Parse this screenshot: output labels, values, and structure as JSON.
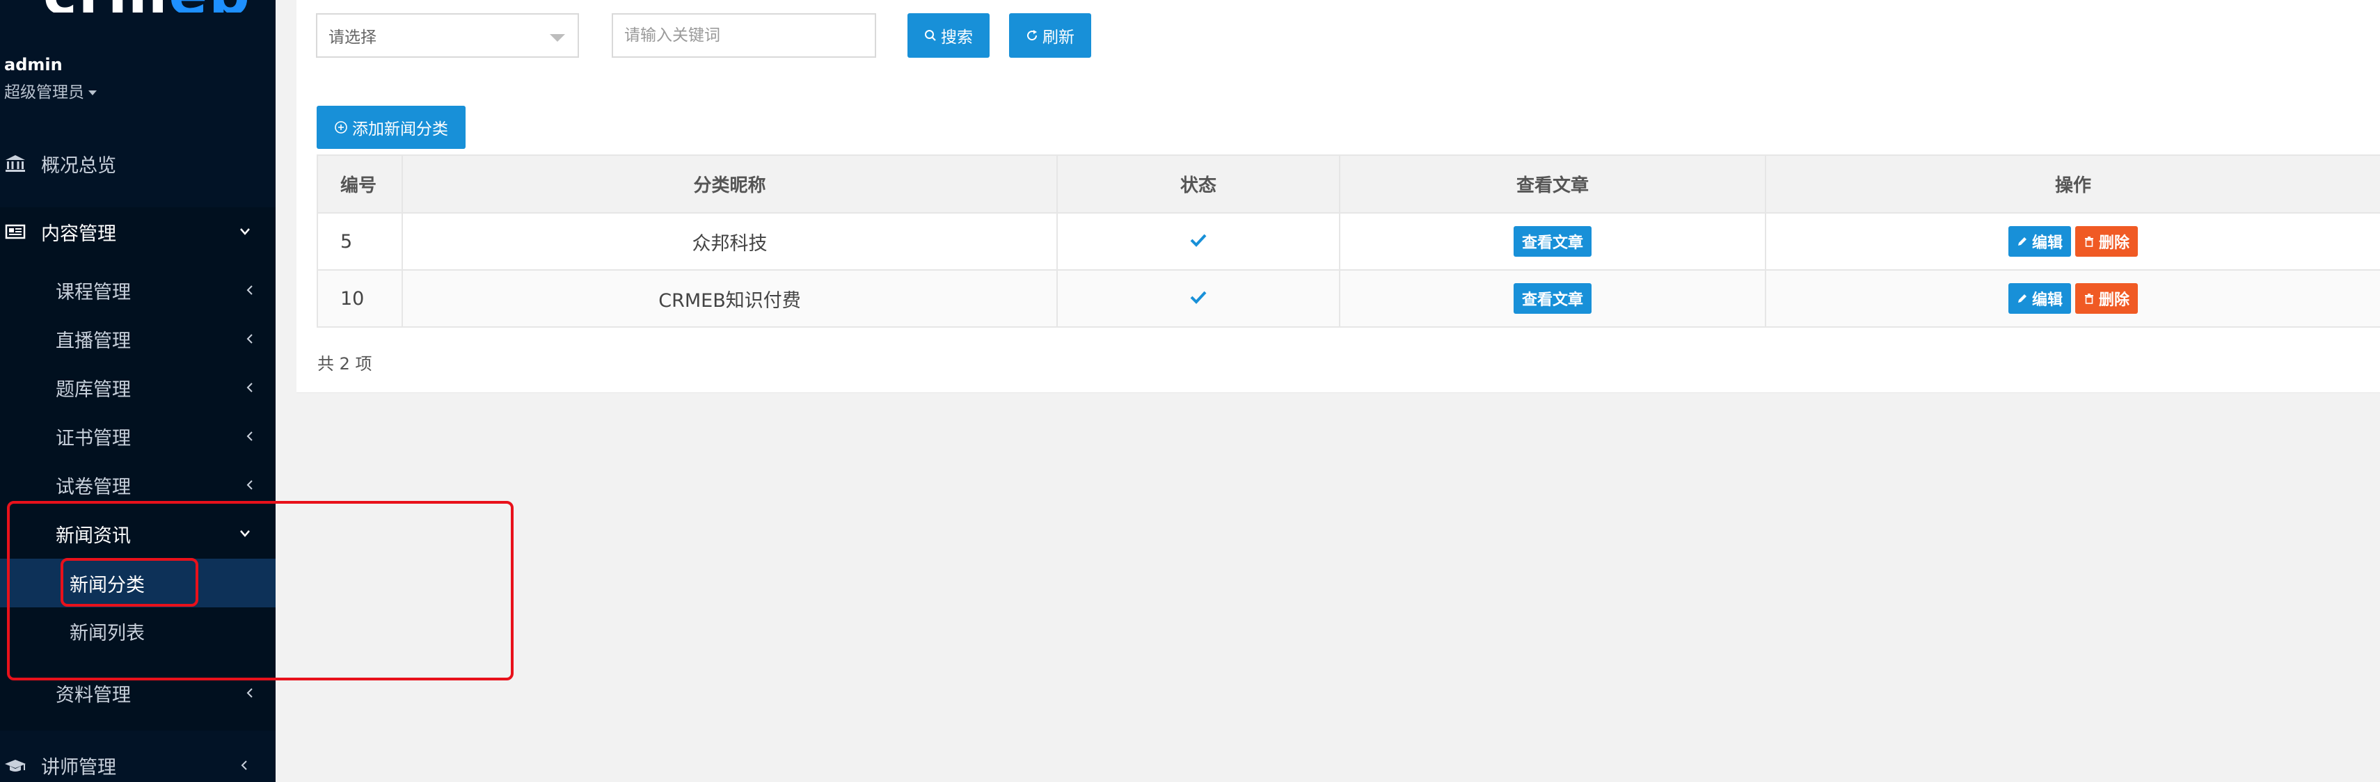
{
  "sidebar": {
    "logo_text_a": "crm",
    "logo_text_b": "eb",
    "user": {
      "name": "admin",
      "role": "超级管理员"
    },
    "items": [
      {
        "label": "概况总览",
        "icon": "bank-icon",
        "indicator": "none"
      },
      {
        "label": "内容管理",
        "icon": "newspaper-icon",
        "indicator": "chevron-down"
      },
      {
        "label": "课程管理",
        "indicator": "chevron-left"
      },
      {
        "label": "直播管理",
        "indicator": "chevron-left"
      },
      {
        "label": "题库管理",
        "indicator": "chevron-left"
      },
      {
        "label": "证书管理",
        "indicator": "chevron-left"
      },
      {
        "label": "试卷管理",
        "indicator": "chevron-left"
      },
      {
        "label": "新闻资讯",
        "indicator": "chevron-down"
      },
      {
        "label": "新闻分类",
        "indicator": "none",
        "active": true
      },
      {
        "label": "新闻列表",
        "indicator": "none"
      },
      {
        "label": "资料管理",
        "indicator": "chevron-left"
      },
      {
        "label": "讲师管理",
        "icon": "graduation-cap-icon",
        "indicator": "chevron-left"
      }
    ]
  },
  "toolbar": {
    "select_value": "请选择",
    "search_placeholder": "请输入关键词",
    "search_label": "搜索",
    "refresh_label": "刷新",
    "add_label": "添加新闻分类"
  },
  "table": {
    "headers": [
      "编号",
      "分类昵称",
      "状态",
      "查看文章",
      "操作"
    ],
    "rows": [
      {
        "id": "5",
        "name": "众邦科技",
        "status": "enabled-check",
        "view_label": "查看文章",
        "edit_label": "编辑",
        "delete_label": "删除"
      },
      {
        "id": "10",
        "name": "CRMEB知识付费",
        "status": "enabled-check",
        "view_label": "查看文章",
        "edit_label": "编辑",
        "delete_label": "删除"
      }
    ],
    "total_text": "共 2 项"
  },
  "colors": {
    "sidebar_bg": "#021326",
    "sidebar_active": "#0d3158",
    "primary": "#1890d8",
    "danger": "#f05a24",
    "annotation": "#e8111b"
  }
}
